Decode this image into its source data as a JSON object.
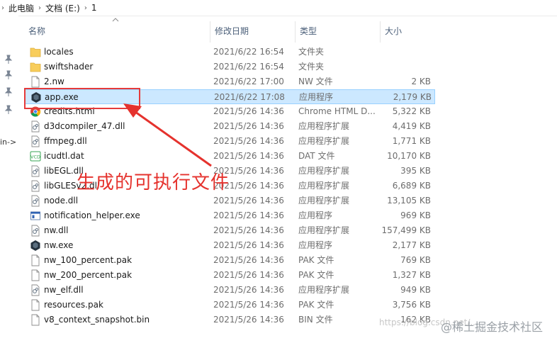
{
  "breadcrumb": [
    "此电脑",
    "文档 (E:)",
    "1"
  ],
  "left_pane": {
    "truncated_label": "in->"
  },
  "columns": {
    "name": "名称",
    "date": "修改日期",
    "type": "类型",
    "size": "大小"
  },
  "files": [
    {
      "icon": "folder",
      "name": "locales",
      "date": "2021/6/22 16:54",
      "type": "文件夹",
      "size": ""
    },
    {
      "icon": "folder",
      "name": "swiftshader",
      "date": "2021/6/22 16:54",
      "type": "文件夹",
      "size": ""
    },
    {
      "icon": "doc",
      "name": "2.nw",
      "date": "2021/6/22 17:00",
      "type": "NW 文件",
      "size": "2 KB"
    },
    {
      "icon": "exe",
      "name": "app.exe",
      "date": "2021/6/22 17:08",
      "type": "应用程序",
      "size": "2,179 KB"
    },
    {
      "icon": "chrome",
      "name": "credits.html",
      "date": "2021/5/26 14:36",
      "type": "Chrome HTML D...",
      "size": "5,322 KB"
    },
    {
      "icon": "dll",
      "name": "d3dcompiler_47.dll",
      "date": "2021/5/26 14:36",
      "type": "应用程序扩展",
      "size": "4,419 KB"
    },
    {
      "icon": "dll",
      "name": "ffmpeg.dll",
      "date": "2021/5/26 14:36",
      "type": "应用程序扩展",
      "size": "1,771 KB"
    },
    {
      "icon": "dat",
      "name": "icudtl.dat",
      "date": "2021/5/26 14:36",
      "type": "DAT 文件",
      "size": "10,170 KB"
    },
    {
      "icon": "dll",
      "name": "libEGL.dll",
      "date": "2021/5/26 14:36",
      "type": "应用程序扩展",
      "size": "395 KB"
    },
    {
      "icon": "dll",
      "name": "libGLESv2.dll",
      "date": "2021/5/26 14:36",
      "type": "应用程序扩展",
      "size": "6,689 KB"
    },
    {
      "icon": "dll",
      "name": "node.dll",
      "date": "2021/5/26 14:36",
      "type": "应用程序扩展",
      "size": "13,105 KB"
    },
    {
      "icon": "window",
      "name": "notification_helper.exe",
      "date": "2021/5/26 14:36",
      "type": "应用程序",
      "size": "969 KB"
    },
    {
      "icon": "dll",
      "name": "nw.dll",
      "date": "2021/5/26 14:36",
      "type": "应用程序扩展",
      "size": "157,499 KB"
    },
    {
      "icon": "exe",
      "name": "nw.exe",
      "date": "2021/5/26 14:36",
      "type": "应用程序",
      "size": "2,177 KB"
    },
    {
      "icon": "doc",
      "name": "nw_100_percent.pak",
      "date": "2021/5/26 14:36",
      "type": "PAK 文件",
      "size": "769 KB"
    },
    {
      "icon": "doc",
      "name": "nw_200_percent.pak",
      "date": "2021/5/26 14:36",
      "type": "PAK 文件",
      "size": "1,327 KB"
    },
    {
      "icon": "dll",
      "name": "nw_elf.dll",
      "date": "2021/5/26 14:36",
      "type": "应用程序扩展",
      "size": "949 KB"
    },
    {
      "icon": "doc",
      "name": "resources.pak",
      "date": "2021/5/26 14:36",
      "type": "PAK 文件",
      "size": "3,756 KB"
    },
    {
      "icon": "doc",
      "name": "v8_context_snapshot.bin",
      "date": "2021/5/26 14:36",
      "type": "BIN 文件",
      "size": "162 KB"
    }
  ],
  "selected_index": 3,
  "annotation": "生成的可执行文件",
  "watermark": "https://blog.csdn.net/...",
  "watermark_logo": "@稀土掘金技术社区",
  "colors": {
    "accent": "#e5322d",
    "selection": "#cce8ff",
    "folder": "#f8cd5b"
  }
}
